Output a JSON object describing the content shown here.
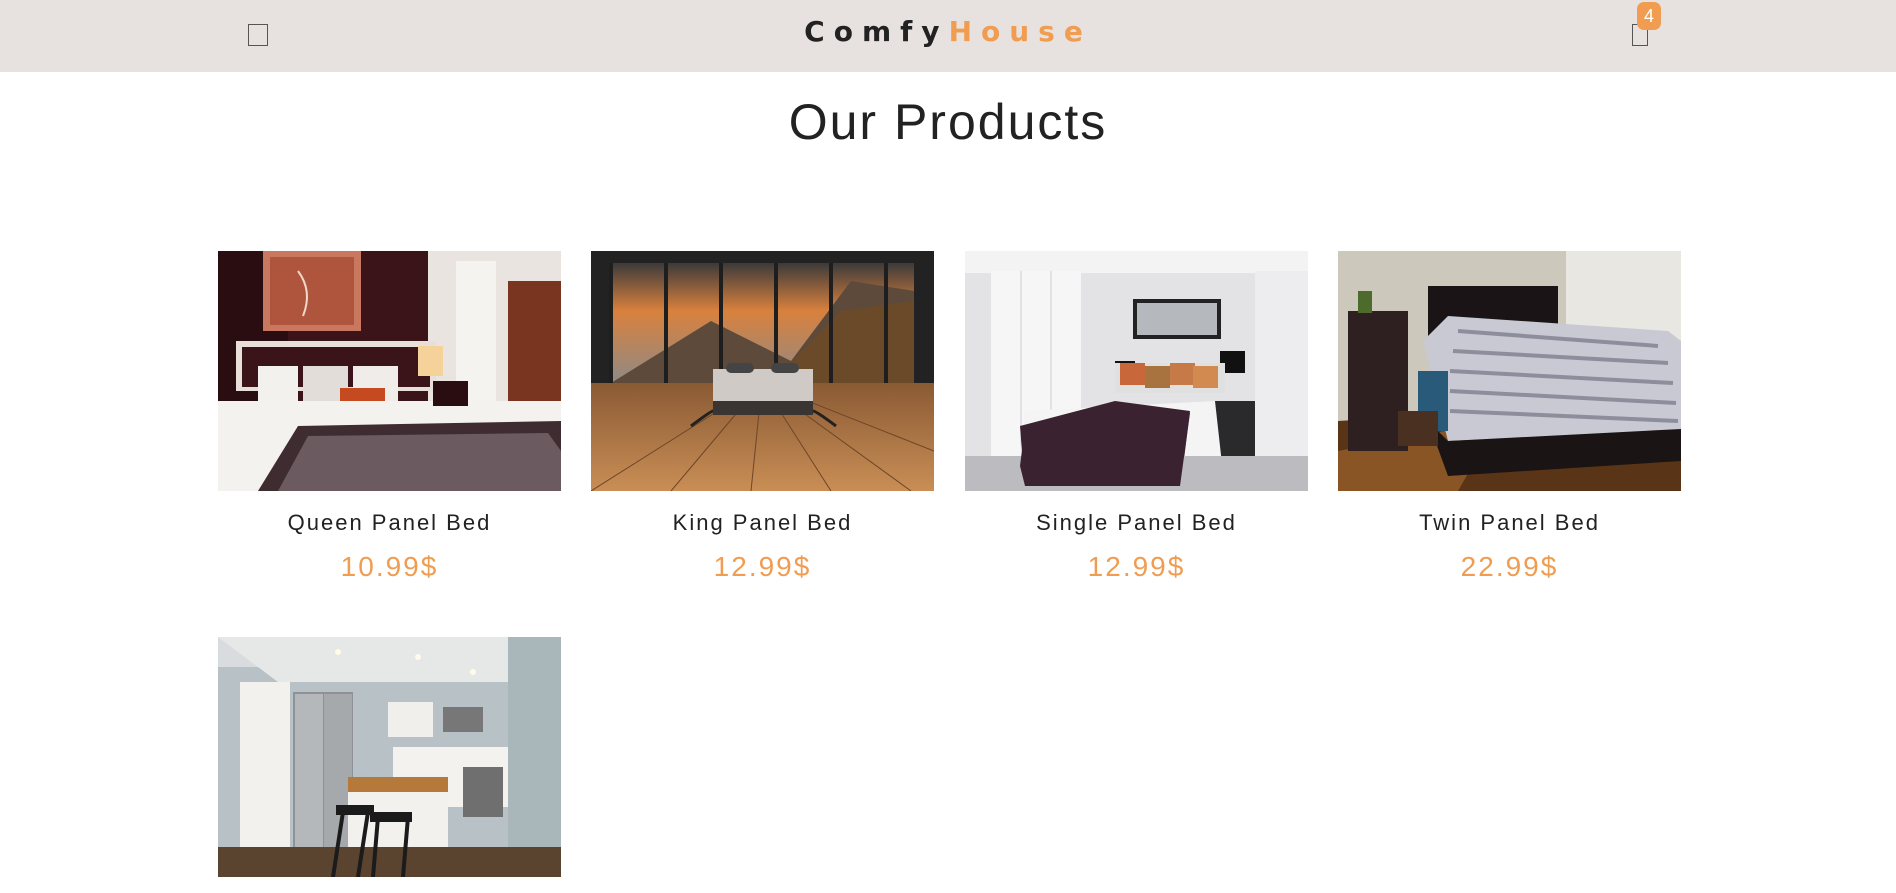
{
  "navbar": {
    "logo_part1": "Comfy",
    "logo_part2": "House",
    "menu_icon": "bars-icon",
    "cart_icon": "cart-icon",
    "cart_count": "4"
  },
  "main": {
    "title": "Our Products"
  },
  "colors": {
    "accent": "#f09d51",
    "navbar_bg": "#e7e2df",
    "text": "#222222"
  },
  "products": [
    {
      "name": "Queen Panel Bed",
      "price": "10.99$"
    },
    {
      "name": "King Panel Bed",
      "price": "12.99$"
    },
    {
      "name": "Single Panel Bed",
      "price": "12.99$"
    },
    {
      "name": "Twin Panel Bed",
      "price": "22.99$"
    },
    {
      "name": "",
      "price": ""
    }
  ]
}
